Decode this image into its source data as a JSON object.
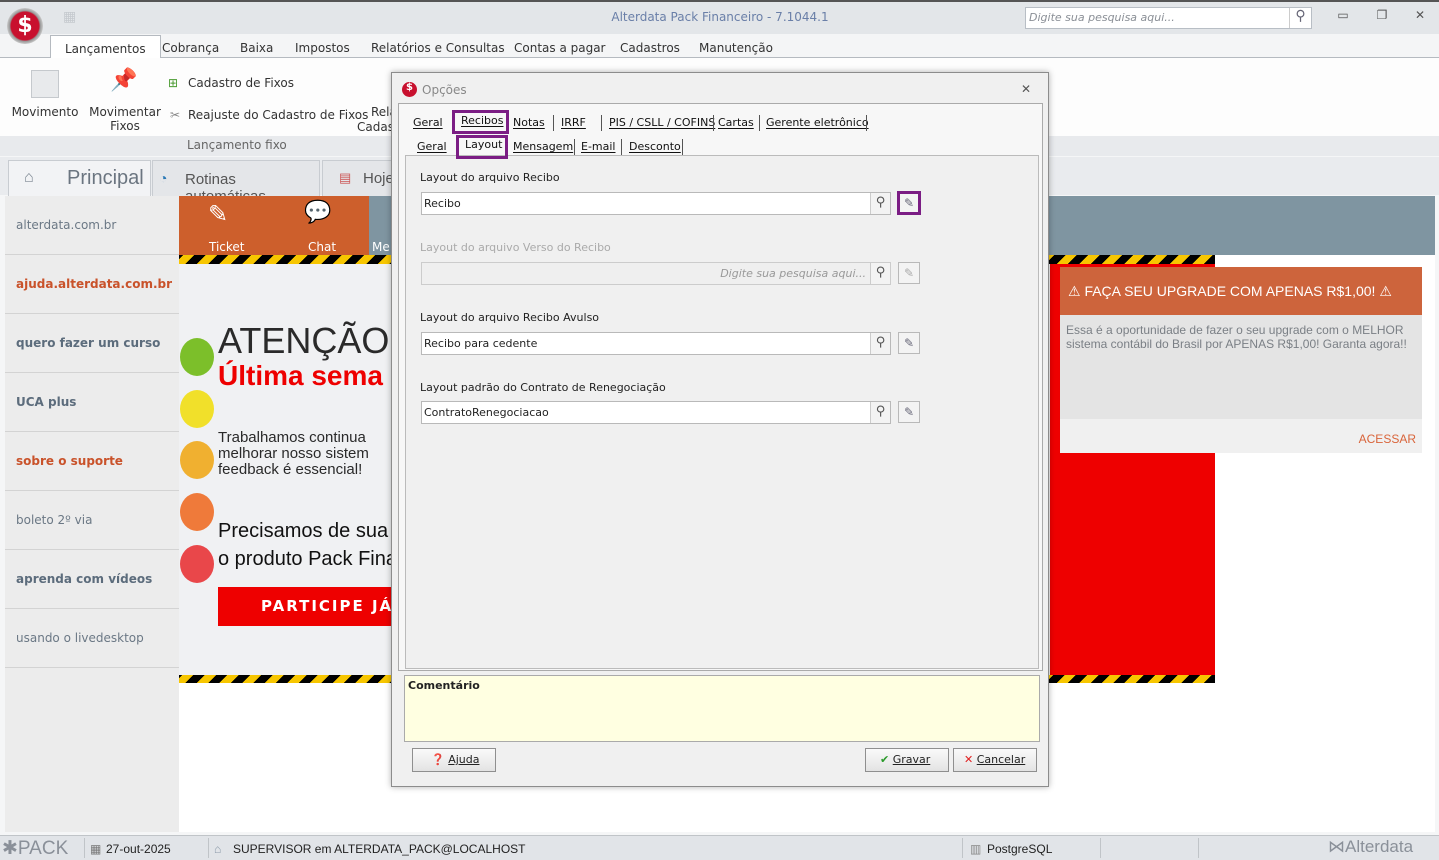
{
  "window": {
    "title": "Alterdata Pack Financeiro - 7.1044.1",
    "search_placeholder": "Digite sua pesquisa aqui..."
  },
  "menu": [
    "Lançamentos",
    "Cobrança",
    "Baixa",
    "Impostos",
    "Relatórios e Consultas",
    "Contas a pagar",
    "Cadastros",
    "Manutenção"
  ],
  "ribbon": {
    "movimento": "Movimento",
    "movimentar": "Movimentar",
    "fixos": "Fixos",
    "cadastro_fixos": "Cadastro de Fixos",
    "reajuste": "Reajuste do Cadastro de Fixos",
    "rela": "Rela",
    "cadast": "Cadast",
    "group": "Lançamento fixo"
  },
  "doc_tabs": {
    "principal": "Principal",
    "rotinas": "Rotinas automáticas",
    "hoje": "Hoje"
  },
  "sidebar": [
    "alterdata.com.br",
    "ajuda.alterdata.com.br",
    "quero fazer um curso",
    "UCA plus",
    "sobre o suporte",
    "boleto 2º via",
    "aprenda com vídeos",
    "usando o livedesktop"
  ],
  "content": {
    "ticket": "Ticket",
    "chat": "Chat",
    "me": "Me",
    "atencao": "ATENÇÃO",
    "ultima": "Última sema",
    "trab1": "Trabalhamos continua",
    "trab2": "melhorar nosso sistem",
    "trab3": "feedback é essencial!",
    "prec1": "Precisamos de sua",
    "prec2": "o produto Pack Fina",
    "participe": "PARTICIPE JÁ"
  },
  "upgrade": {
    "title": "⚠ FAÇA SEU UPGRADE COM APENAS R$1,00! ⚠",
    "body": "Essa é a oportunidade de fazer o seu upgrade com o MELHOR sistema contábil do Brasil por APENAS R$1,00! Garanta agora!!",
    "link": "ACESSAR"
  },
  "dialog": {
    "title": "Opções",
    "tabs": [
      "Geral",
      "Recibos",
      "Notas",
      "IRRF",
      "PIS / CSLL / COFINS",
      "Cartas",
      "Gerente eletrônico"
    ],
    "subtabs": [
      "Geral",
      "Layout",
      "Mensagem",
      "E-mail",
      "Desconto"
    ],
    "fields": [
      {
        "label": "Layout do arquivo Recibo",
        "value": "Recibo"
      },
      {
        "label": "Layout do arquivo Verso do Recibo",
        "placeholder": "Digite sua pesquisa aqui..."
      },
      {
        "label": "Layout do arquivo Recibo Avulso",
        "value": "Recibo para cedente"
      },
      {
        "label": "Layout padrão do Contrato de Renegociação",
        "value": "ContratoRenegociacao"
      }
    ],
    "comment_label": "Comentário",
    "help": "Ajuda",
    "save": "Gravar",
    "cancel": "Cancelar"
  },
  "status": {
    "pack": "PACK",
    "date": "27-out-2025",
    "user": "SUPERVISOR em ALTERDATA_PACK@LOCALHOST",
    "db": "PostgreSQL",
    "brand": "Alterdata"
  },
  "colors": {
    "accent": "#7b1d84",
    "orange": "#cd5f2c",
    "red": "#ee0000"
  }
}
